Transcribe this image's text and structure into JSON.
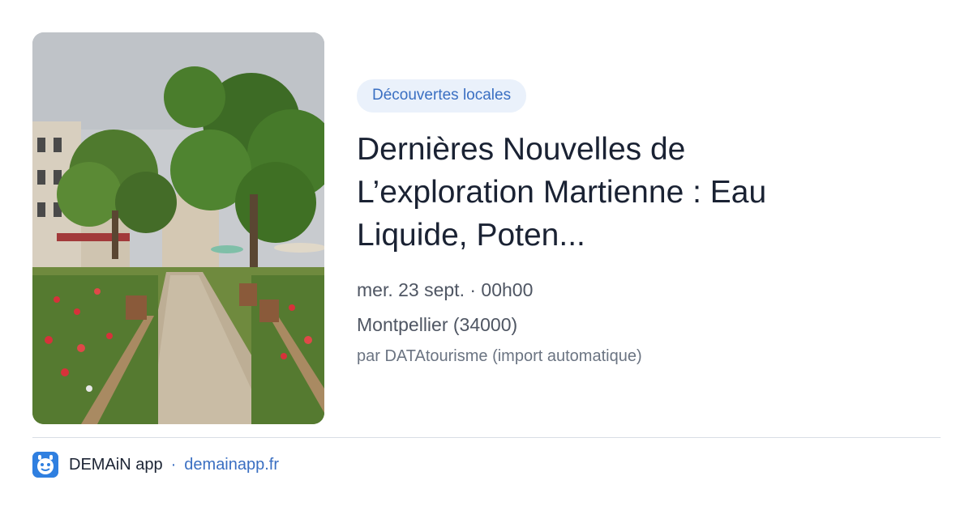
{
  "card": {
    "category_tag": "Découvertes locales",
    "title_lines": [
      "Dernières Nouvelles de",
      "L’exploration Martienne : Eau",
      "Liquide, Poten..."
    ],
    "date_time": "mer. 23 sept. · 00h00",
    "location": "Montpellier (34000)",
    "source": "par DATAtourisme (import automatique)",
    "image": "photo-garden-alley"
  },
  "footer": {
    "app_icon": "demain-app-icon",
    "app_name": "DEMAiN app",
    "separator": "·",
    "app_url": "demainapp.fr"
  },
  "colors": {
    "tag_bg": "#eaf1fb",
    "accent": "#3a6fc2",
    "title": "#1a2233",
    "meta": "#4f5663",
    "app_icon": "#2f7fe0"
  }
}
